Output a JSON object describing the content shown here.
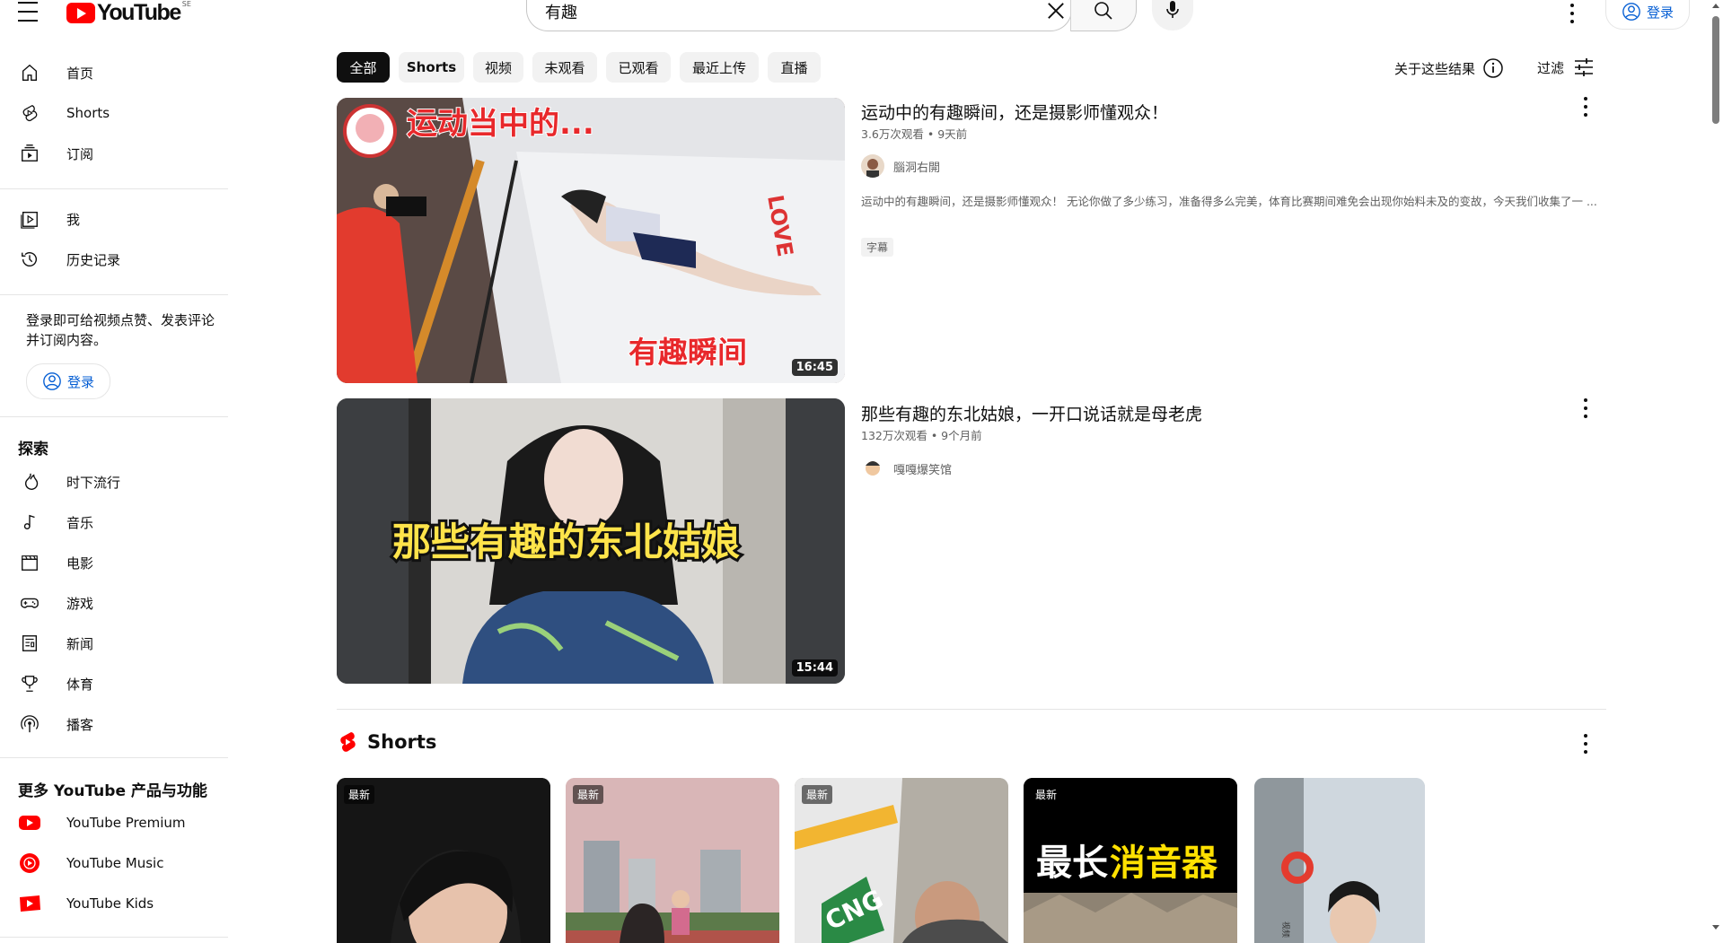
{
  "header": {
    "logo_text": "YouTube",
    "logo_country": "SE",
    "search_value": "有趣",
    "signin_label": "登录"
  },
  "sidebar": {
    "main": [
      {
        "label": "首页",
        "icon": "home-icon"
      },
      {
        "label": "Shorts",
        "icon": "shorts-icon"
      },
      {
        "label": "订阅",
        "icon": "subscriptions-icon"
      }
    ],
    "you": [
      {
        "label": "我",
        "icon": "you-icon"
      },
      {
        "label": "历史记录",
        "icon": "history-icon"
      }
    ],
    "signin_prompt": "登录即可给视频点赞、发表评论并订阅内容。",
    "signin_label": "登录",
    "explore_title": "探索",
    "explore": [
      {
        "label": "时下流行",
        "icon": "trending-icon"
      },
      {
        "label": "音乐",
        "icon": "music-icon"
      },
      {
        "label": "电影",
        "icon": "movies-icon"
      },
      {
        "label": "游戏",
        "icon": "gaming-icon"
      },
      {
        "label": "新闻",
        "icon": "news-icon"
      },
      {
        "label": "体育",
        "icon": "sports-icon"
      },
      {
        "label": "播客",
        "icon": "podcasts-icon"
      }
    ],
    "more_title": "更多 YouTube 产品与功能",
    "more": [
      {
        "label": "YouTube Premium",
        "icon": "youtube-premium-icon"
      },
      {
        "label": "YouTube Music",
        "icon": "youtube-music-icon"
      },
      {
        "label": "YouTube Kids",
        "icon": "youtube-kids-icon"
      }
    ]
  },
  "chips": [
    "全部",
    "Shorts",
    "视频",
    "未观看",
    "已观看",
    "最近上传",
    "直播"
  ],
  "about_label": "关于这些结果",
  "filter_label": "过滤",
  "results": [
    {
      "title": "运动中的有趣瞬间，还是摄影师懂观众！",
      "meta": "3.6万次观看 • 9天前",
      "channel": "腦洞右開",
      "description": "运动中的有趣瞬间，还是摄影师懂观众！ 无论你做了多少练习，准备得多么完美，体育比赛期间难免会出现你始料未及的变故，今天我们收集了一 ...",
      "badge": "字幕",
      "duration": "16:45",
      "thumb_text_top": "运动当中的...",
      "thumb_text_bottom": "有趣瞬间"
    },
    {
      "title": "那些有趣的东北姑娘，一开口说话就是母老虎",
      "meta": "132万次观看 • 9个月前",
      "channel": "嘎嘎爆笑馆",
      "duration": "15:44",
      "thumb_text": "那些有趣的东北姑娘"
    }
  ],
  "shorts_section": {
    "title": "Shorts",
    "badge": "最新",
    "card4_text_a": "最长",
    "card4_text_b": "消音器",
    "card3_text": "CNG",
    "card5_text": "视频"
  },
  "colors": {
    "accent": "#ff0000",
    "link": "#065fd4"
  }
}
